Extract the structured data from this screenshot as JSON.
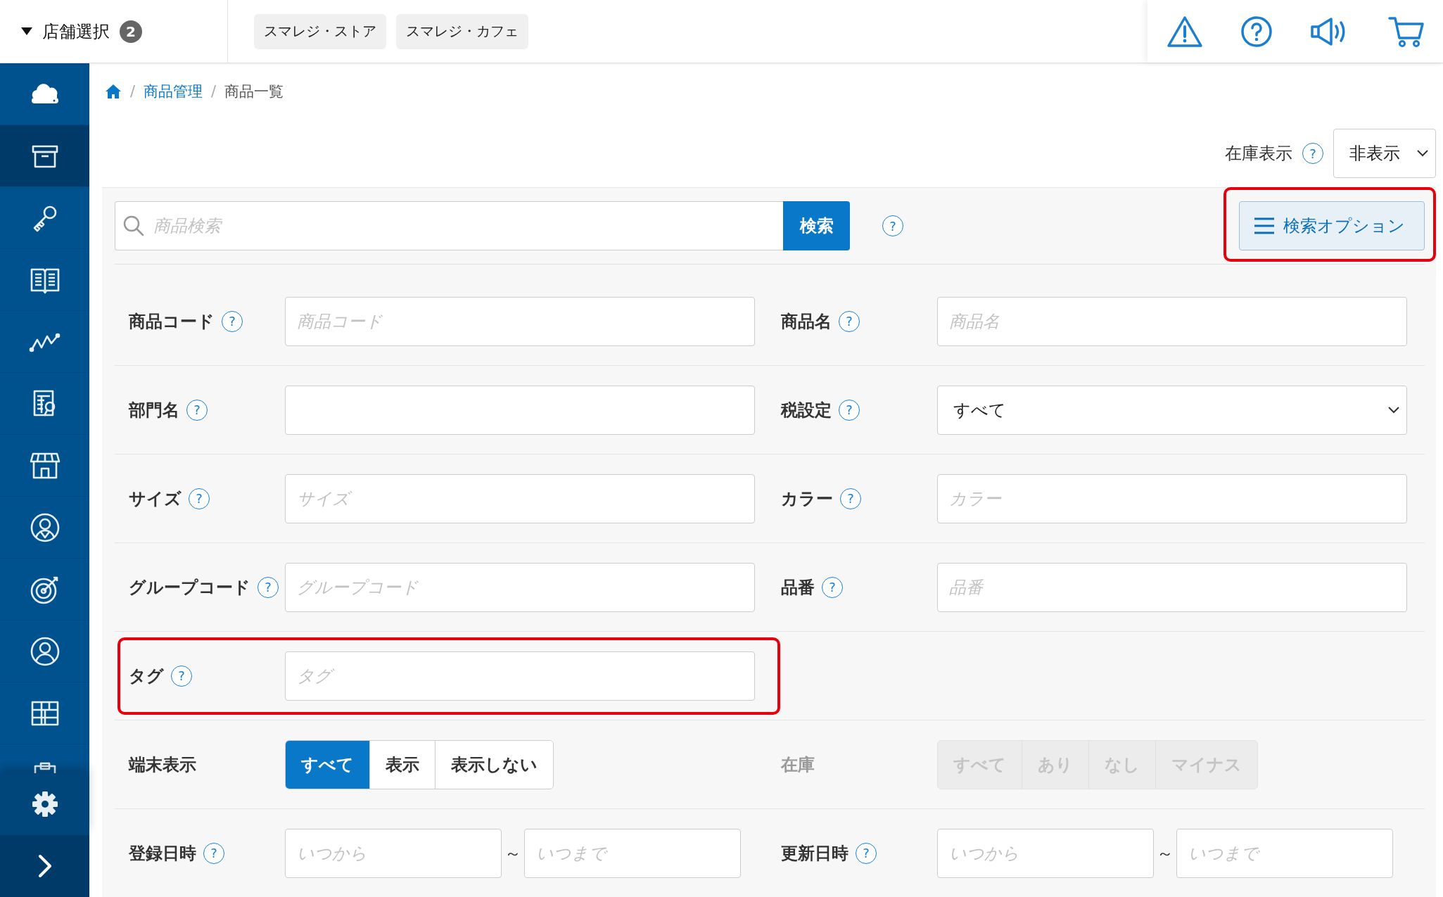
{
  "topbar": {
    "store_selector": {
      "label": "店舗選択",
      "count": "2"
    },
    "store_tabs": [
      "スマレジ・ストア",
      "スマレジ・カフェ"
    ],
    "actions": [
      {
        "kind": "warning"
      },
      {
        "kind": "help"
      },
      {
        "kind": "announce"
      },
      {
        "kind": "cart"
      }
    ]
  },
  "sidebar": {
    "items": [
      {
        "kind": "cloud",
        "selected": false
      },
      {
        "kind": "box",
        "selected": true
      },
      {
        "kind": "key",
        "selected": false
      },
      {
        "kind": "book",
        "selected": false
      },
      {
        "kind": "chart",
        "selected": false
      },
      {
        "kind": "report",
        "selected": false
      },
      {
        "kind": "store",
        "selected": false
      },
      {
        "kind": "staff",
        "selected": false
      },
      {
        "kind": "target",
        "selected": false
      },
      {
        "kind": "user",
        "selected": false
      },
      {
        "kind": "grid",
        "selected": false
      },
      {
        "kind": "clipboard",
        "selected": false
      }
    ],
    "footer": [
      {
        "kind": "gear"
      },
      {
        "kind": "expand"
      }
    ]
  },
  "breadcrumb": [
    {
      "separator": "/",
      "label": "商品管理"
    },
    {
      "separator": "/",
      "label": "商品一覧"
    }
  ],
  "stock_display": {
    "label": "在庫表示",
    "help": "?",
    "value": "非表示"
  },
  "search": {
    "placeholder": "商品検索",
    "button": "検索",
    "help": "?"
  },
  "options_button": {
    "label": "検索オプション",
    "highlighted": true
  },
  "fields": [
    {
      "kind": "text",
      "label": "商品コード",
      "help": "?",
      "placeholder": "商品コード",
      "highlighted": false
    },
    {
      "kind": "text",
      "label": "商品名",
      "help": "?",
      "placeholder": "商品名",
      "highlighted": false
    },
    {
      "kind": "text",
      "label": "部門名",
      "help": "?",
      "highlighted": false
    },
    {
      "kind": "select",
      "label": "税設定",
      "help": "?",
      "value": "すべて",
      "highlighted": false
    },
    {
      "kind": "text",
      "label": "サイズ",
      "help": "?",
      "placeholder": "サイズ",
      "highlighted": false
    },
    {
      "kind": "text",
      "label": "カラー",
      "help": "?",
      "placeholder": "カラー",
      "highlighted": false
    },
    {
      "kind": "text",
      "label": "グループコード",
      "help": "?",
      "placeholder": "グループコード",
      "highlighted": false
    },
    {
      "kind": "text",
      "label": "品番",
      "help": "?",
      "placeholder": "品番",
      "highlighted": false
    },
    {
      "kind": "text",
      "label": "タグ",
      "help": "?",
      "placeholder": "タグ",
      "highlighted": true
    },
    {
      "kind": "empty"
    },
    {
      "kind": "segment",
      "label": "端末表示",
      "disabled": false,
      "options": [
        {
          "label": "すべて",
          "selected": true
        },
        {
          "label": "表示",
          "selected": false
        },
        {
          "label": "表示しない",
          "selected": false
        }
      ]
    },
    {
      "kind": "segment",
      "label": "在庫",
      "disabled": true,
      "options": [
        {
          "label": "すべて",
          "selected": false
        },
        {
          "label": "あり",
          "selected": false
        },
        {
          "label": "なし",
          "selected": false
        },
        {
          "label": "マイナス",
          "selected": false
        }
      ]
    },
    {
      "kind": "range",
      "label": "登録日時",
      "help": "?",
      "from": {
        "placeholder": "いつから"
      },
      "separator": "～",
      "to": {
        "placeholder": "いつまで"
      }
    },
    {
      "kind": "range",
      "label": "更新日時",
      "help": "?",
      "from": {
        "placeholder": "いつから"
      },
      "separator": "～",
      "to": {
        "placeholder": "いつまで"
      }
    }
  ]
}
